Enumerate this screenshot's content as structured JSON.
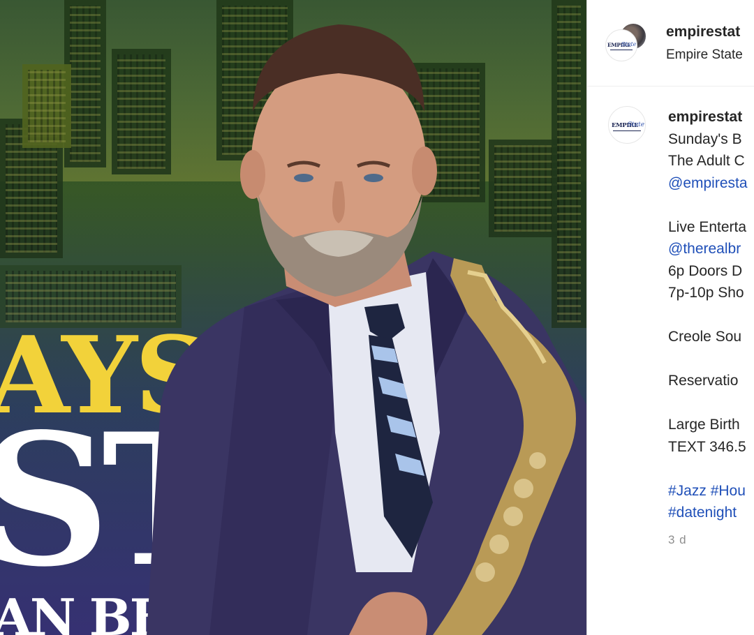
{
  "post_image": {
    "promo_line1": "AYS",
    "promo_line2": "ST",
    "promo_line3": "AN BEST"
  },
  "header": {
    "username": "empirestat",
    "location": "Empire State"
  },
  "caption": {
    "username": "empirestat",
    "lines": [
      "Sunday's B",
      "The Adult C",
      "@empiresta",
      "",
      "Live Enterta",
      "@therealbr",
      "6p Doors D",
      "7p-10p Sho",
      "",
      "Creole Sou",
      "",
      "Reservatio",
      "",
      "Large Birth",
      "TEXT 346.5",
      "",
      "#Jazz #Hou",
      "#datenight"
    ]
  },
  "timestamp": "3 d",
  "avatar_logo": {
    "text_left": "EMPIRE",
    "text_right": "State"
  },
  "colors": {
    "link": "#1f4fb8",
    "text": "#262626",
    "muted": "#8e8e8e",
    "promo_yellow": "#f2d23a"
  }
}
